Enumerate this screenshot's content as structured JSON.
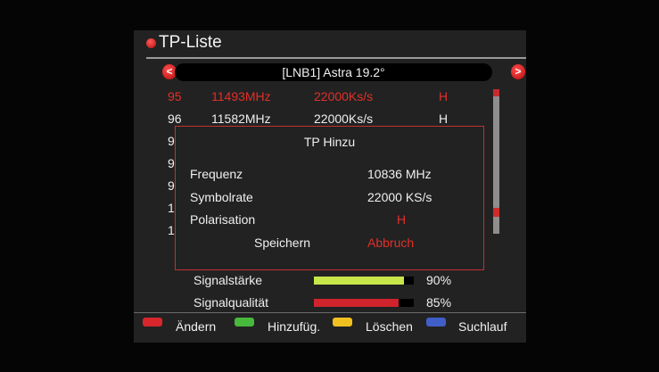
{
  "header": {
    "title": "TP-Liste"
  },
  "satellite": {
    "label": "[LNB1] Astra 19.2°",
    "left_arrow": "<",
    "right_arrow": ">"
  },
  "transponders": [
    {
      "num": "95",
      "freq": "11493MHz",
      "sym": "22000Ks/s",
      "pol": "H"
    },
    {
      "num": "96",
      "freq": "11582MHz",
      "sym": "22000Ks/s",
      "pol": "H"
    },
    {
      "num": "9",
      "freq": "",
      "sym": "",
      "pol": ""
    },
    {
      "num": "9",
      "freq": "",
      "sym": "",
      "pol": ""
    },
    {
      "num": "9",
      "freq": "",
      "sym": "",
      "pol": ""
    },
    {
      "num": "1",
      "freq": "",
      "sym": "",
      "pol": ""
    },
    {
      "num": "1",
      "freq": "",
      "sym": "",
      "pol": ""
    }
  ],
  "dialog": {
    "title": "TP Hinzu",
    "frequency_label": "Frequenz",
    "frequency_value": "10836 MHz",
    "symbolrate_label": "Symbolrate",
    "symbolrate_value": "22000 KS/s",
    "polarisation_label": "Polarisation",
    "polarisation_value": "H",
    "save_label": "Speichern",
    "cancel_label": "Abbruch"
  },
  "signal": {
    "strength_label": "Signalstärke",
    "strength_value": "90%",
    "strength_fraction": 0.9,
    "quality_label": "Signalqualität",
    "quality_value": "85%",
    "quality_fraction": 0.85
  },
  "footer": {
    "edit": "Ändern",
    "add": "Hinzufüg.",
    "delete": "Löschen",
    "scan": "Suchlauf"
  },
  "colors": {
    "accent_red": "#e0302a",
    "strength_bar": "#c7e64a",
    "quality_bar": "#d0232b",
    "key_red": "#d8262c",
    "key_green": "#48b83c",
    "key_yellow": "#f1c21f",
    "key_blue": "#3f5ec8"
  }
}
